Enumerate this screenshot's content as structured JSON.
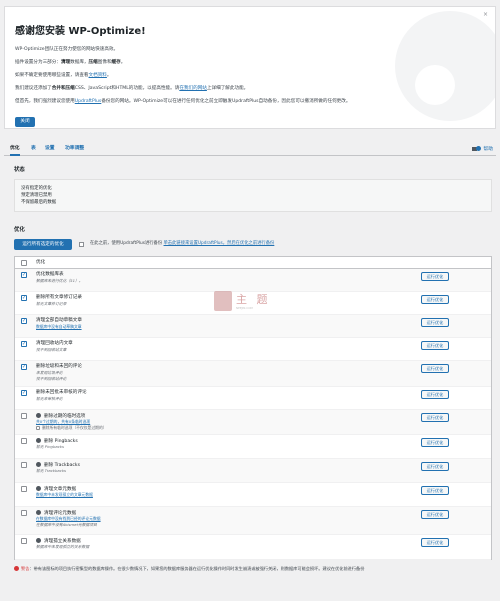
{
  "welcome": {
    "dismiss": "×",
    "title": "感谢您安装 WP-Optimize!",
    "p1": "WP-Optimize团队正在努力使您的网站快速高效。",
    "p2_pre": "插件设置分为三部分：",
    "p2_b1": "清理",
    "p2_mid1": "数据库，",
    "p2_b2": "压缩",
    "p2_mid2": "图像和",
    "p2_b3": "缓存",
    "p2_post": "。",
    "p3_pre": "如果不确定要使用哪些设置，请查看",
    "p3_link": "文档资料",
    "p3_post": "。",
    "p4_pre": "我们建议还添加了",
    "p4_b": "合并和压缩",
    "p4_mid": "CSS、JavaScript和HTML的功能，以提高性能。请",
    "p4_link": "在我们的网站",
    "p4_post": "上详细了解此功能。",
    "p5_pre": "但首先，我们强烈建议您使用",
    "p5_link": "UpdraftPlus",
    "p5_post": "备份您的网站。WP-Optimize可以在进行任何优化之前立即触发UpdraftPlus自动备份，因此您可以撤消所做的任何更改。",
    "close_label": "关闭"
  },
  "tabs": [
    "优化",
    "表",
    "设置",
    "功率调整"
  ],
  "help_label": "帮助",
  "status": {
    "heading": "状态",
    "lines": [
      "没有指定的优化",
      "预定清理已禁用",
      "不保留最后的数据"
    ]
  },
  "optimizations": {
    "heading": "优化",
    "run_all_label": "运行所有选定的优化",
    "keep_text": "在此之前，使用UpdraftPlus进行备份",
    "keep_link": "单击此链接来设置UpdraftPlus，然后在优化之前进行备份",
    "header_label": "优化",
    "run_label": "运行优化",
    "rows": [
      {
        "title": "优化数据库表",
        "sub": "数据库未进行优化（51）。",
        "checked": true
      },
      {
        "title": "删除所有文章修订记录",
        "sub": "暂无文章修订记录",
        "checked": true
      },
      {
        "title": "清理全部自动草稿文章",
        "sub": "数据库中没有自动草稿文章",
        "checked": true
      },
      {
        "title": "清理回收站内文章",
        "sub": "找不到回收站文章",
        "checked": true
      },
      {
        "title": "删除垃圾和未回的评论",
        "sub": "未发现垃圾评论",
        "sub2": "找不到回收站评论",
        "checked": true
      },
      {
        "title": "删除未回批未审核的评论",
        "sub": "暂无未审核评论",
        "checked": true
      },
      {
        "title": "删除过期的临时选项",
        "sub": "共0个过期的，共有0条临时选项",
        "subcb": "删除所有临时选项（不仅仅是过期的）",
        "checked": false,
        "dot": true
      },
      {
        "title": "删除 Pingbacks",
        "sub": "暂无 Pingbacks",
        "checked": false,
        "dot": true
      },
      {
        "title": "删除 Trackbacks",
        "sub": "暂无 Trackbacks",
        "checked": false,
        "dot": true
      },
      {
        "title": "清理文章元数据",
        "sub": "数据库中未发现孤立的文章元数据",
        "checked": false,
        "dot": true
      },
      {
        "title": "清理评论元数据",
        "sub": "在数据库中没有找到已经的评论元数据",
        "sub2": "在数据库中没有Akismet元数据项目",
        "checked": false,
        "dot": true
      },
      {
        "title": "清理孤立关系数据",
        "sub": "数据库中未发现孤立的关系数据",
        "checked": false,
        "dot": true
      }
    ]
  },
  "watermark": {
    "text": "主 题",
    "sub": "NEEJIN.COM"
  },
  "warning": {
    "label": "警告",
    "text": "：带有该图标的项目执行密集型的数据库操作。在很少数情况下，如果您的数据库服务器在运行优化操作时同时发生崩溃或被强行关闭，则数据库可能会损坏。建议在优化前进行备份"
  }
}
